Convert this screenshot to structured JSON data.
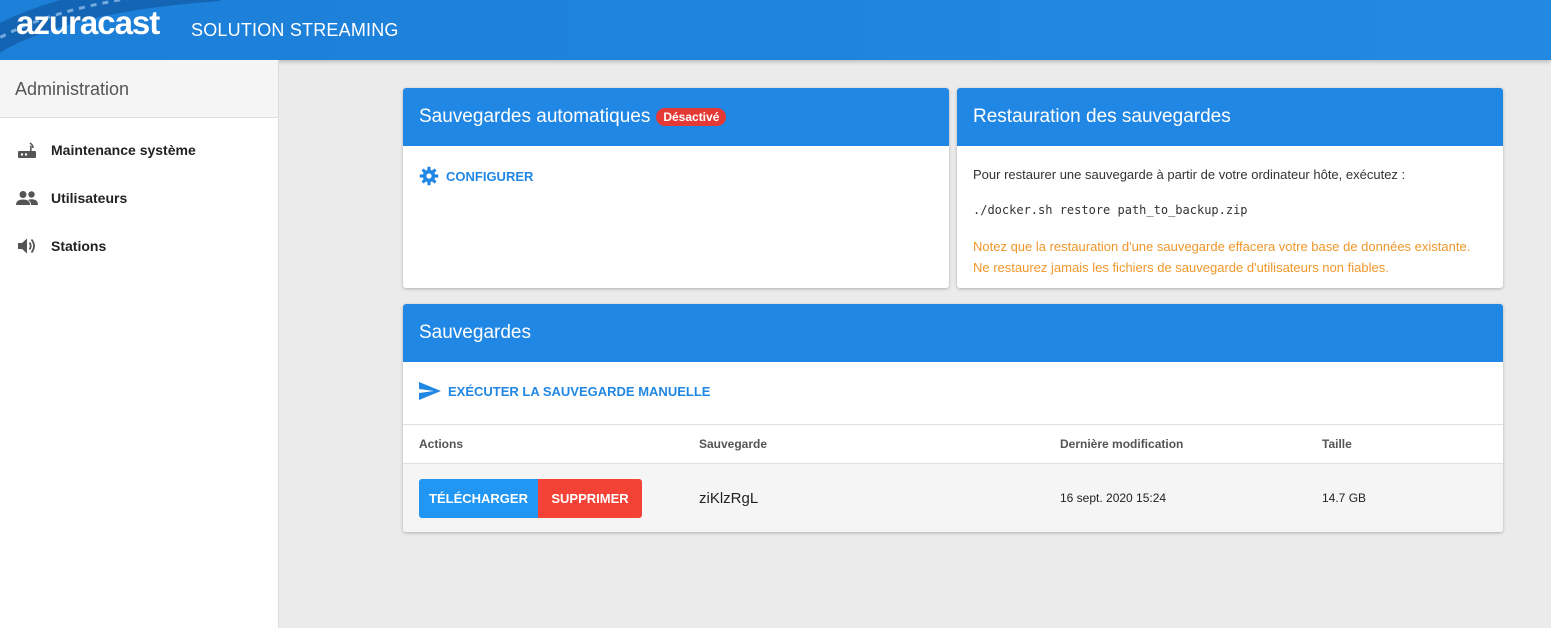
{
  "header": {
    "brand_bold": "azura",
    "brand_rest": "cast",
    "subtitle": "SOLUTION STREAMING"
  },
  "sidebar": {
    "title": "Administration",
    "items": [
      {
        "label": "Maintenance système",
        "icon": "router-icon"
      },
      {
        "label": "Utilisateurs",
        "icon": "users-icon"
      },
      {
        "label": "Stations",
        "icon": "volume-icon"
      }
    ]
  },
  "auto_backups": {
    "title": "Sauvegardes automatiques",
    "badge": "Désactivé",
    "configure_label": "CONFIGURER"
  },
  "restore": {
    "title": "Restauration des sauvegardes",
    "intro": "Pour restaurer une sauvegarde à partir de votre ordinateur hôte, exécutez :",
    "command": "./docker.sh restore path_to_backup.zip",
    "warning": "Notez que la restauration d'une sauvegarde effacera votre base de données existante. Ne restaurez jamais les fichiers de sauvegarde d'utilisateurs non fiables."
  },
  "backups": {
    "title": "Sauvegardes",
    "manual_label": "EXÉCUTER LA SAUVEGARDE MANUELLE",
    "columns": [
      "Actions",
      "Sauvegarde",
      "Dernière modification",
      "Taille"
    ],
    "rows": [
      {
        "download_label": "TÉLÉCHARGER",
        "delete_label": "SUPPRIMER",
        "name": "ziKlzRgL",
        "modified": "16 sept. 2020 15:24",
        "size": "14.7 GB"
      }
    ]
  },
  "colors": {
    "primary": "#2187e4",
    "danger": "#f44336",
    "warning": "#f0972a"
  }
}
